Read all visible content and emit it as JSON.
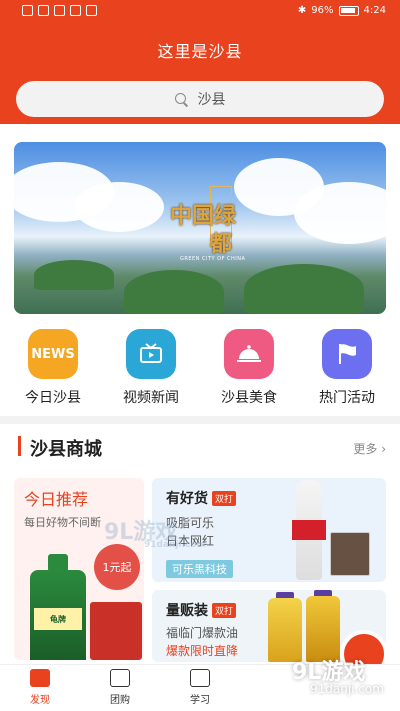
{
  "status_bar": {
    "battery": "96%",
    "time": "4:24"
  },
  "header": {
    "title": "这里是沙县",
    "search_text": "沙县"
  },
  "banner": {
    "text_line1": "中国绿",
    "text_line2": "都",
    "subtitle": "GREEN CITY OF CHINA"
  },
  "quick_nav": [
    {
      "label": "今日沙县",
      "icon": "news-icon",
      "icon_text": "NEWS",
      "color": "#f5a623"
    },
    {
      "label": "视频新闻",
      "icon": "tv-icon",
      "icon_text": "",
      "color": "#2aa7d6"
    },
    {
      "label": "沙县美食",
      "icon": "food-cloche-icon",
      "icon_text": "",
      "color": "#ee5a82"
    },
    {
      "label": "热门活动",
      "icon": "flag-icon",
      "icon_text": "",
      "color": "#6b6ff0"
    }
  ],
  "section": {
    "title": "沙县商城",
    "more": "更多"
  },
  "cards": {
    "left": {
      "title": "今日推荐",
      "subtitle": "每日好物不间断",
      "price_badge": "1元起",
      "product_label": "龟牌"
    },
    "right1": {
      "title": "有好货",
      "tag": "双打",
      "line1": "吸脂可乐",
      "line2": "日本网红",
      "chip": "可乐黑科技"
    },
    "right2": {
      "title": "量贩装",
      "tag": "双打",
      "line1": "福临门爆款油",
      "line2": "爆款限时直降"
    }
  },
  "tab_bar": [
    {
      "label": "发现",
      "active": true
    },
    {
      "label": "团购",
      "active": false
    },
    {
      "label": "学习",
      "active": false
    }
  ],
  "watermark": {
    "text": "9L游戏",
    "site": "91danji.com",
    "center_text": "9L游戏"
  },
  "colors": {
    "brand_red": "#e8421f"
  }
}
